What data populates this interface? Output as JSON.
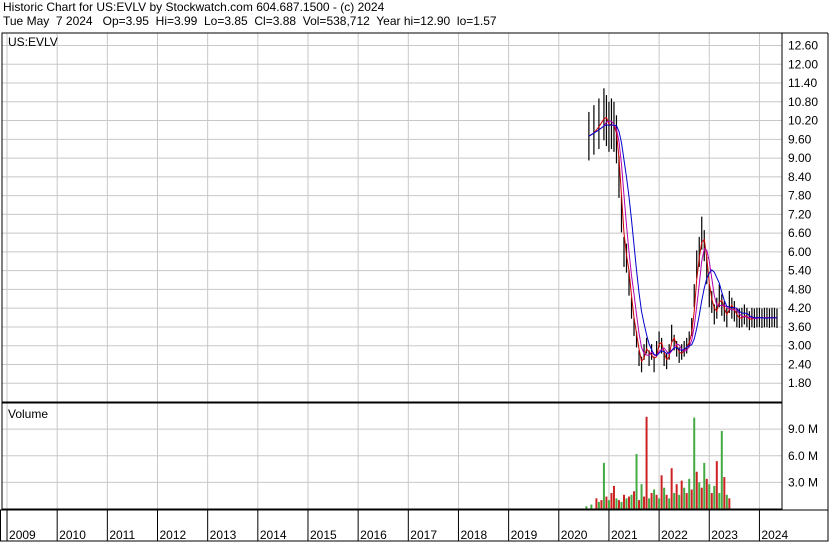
{
  "header": {
    "line1": "Historic Chart for US:EVLV by Stockwatch.com 604.687.1500 - (c) 2024",
    "line2": "Tue May  7 2024   Op=3.95  Hi=3.99  Lo=3.85  Cl=3.88  Vol=538,712  Year hi=12.90  lo=1.57"
  },
  "colors": {
    "grid": "#c8c8c8",
    "frame": "#000000",
    "price_bar": "#000000",
    "ma_short": "#cc0000",
    "ma_mid": "#b000b0",
    "ma_long": "#0000cc",
    "vol_up": "#44aa44",
    "vol_down": "#cc2222"
  },
  "chart_data": [
    {
      "type": "line",
      "panel_label": "US:EVLV",
      "ylim": [
        1.2,
        13.0
      ],
      "y_ticks": [
        "12.60",
        "12.00",
        "11.40",
        "10.80",
        "10.20",
        "9.60",
        "9.00",
        "8.40",
        "7.80",
        "7.20",
        "6.60",
        "6.00",
        "5.40",
        "4.80",
        "4.20",
        "3.60",
        "3.00",
        "2.40",
        "1.80"
      ],
      "x_ticks": [
        "2009",
        "2010",
        "2011",
        "2012",
        "2013",
        "2014",
        "2015",
        "2016",
        "2017",
        "2018",
        "2019",
        "2020",
        "2021",
        "2022",
        "2023",
        "2024"
      ],
      "xlim": [
        2008.9,
        2024.45
      ],
      "series": [
        {
          "x": [
            2020.6,
            2020.7,
            2020.8,
            2020.9,
            2020.95,
            2021.0,
            2021.05,
            2021.1,
            2021.15,
            2021.2,
            2021.25,
            2021.3,
            2021.35,
            2021.4,
            2021.45,
            2021.5,
            2021.55,
            2021.6,
            2021.65,
            2021.7,
            2021.75,
            2021.8,
            2021.85,
            2021.9,
            2021.95,
            2022.0,
            2022.05,
            2022.1,
            2022.15,
            2022.2,
            2022.25,
            2022.3,
            2022.35,
            2022.4,
            2022.45,
            2022.5,
            2022.55,
            2022.6,
            2022.65,
            2022.7,
            2022.75,
            2022.8,
            2022.85,
            2022.9,
            2022.95,
            2023.0,
            2023.05,
            2023.1,
            2023.15,
            2023.2,
            2023.25,
            2023.3,
            2023.35,
            2023.4,
            2023.45,
            2023.5,
            2023.55,
            2023.6,
            2023.65,
            2023.7,
            2023.75,
            2023.8,
            2023.85,
            2023.9,
            2023.95,
            2024.0,
            2024.05,
            2024.1,
            2024.15,
            2024.2,
            2024.25,
            2024.3,
            2024.35
          ],
          "values": [
            9.7,
            9.9,
            10.1,
            10.4,
            10.2,
            10.0,
            10.1,
            10.0,
            9.6,
            8.4,
            7.2,
            6.0,
            5.8,
            5.0,
            4.2,
            3.6,
            3.2,
            2.6,
            2.4,
            2.8,
            3.0,
            2.6,
            2.8,
            2.4,
            2.9,
            3.2,
            3.0,
            2.6,
            2.5,
            2.8,
            3.4,
            3.1,
            2.9,
            2.7,
            2.8,
            2.9,
            3.0,
            3.2,
            3.6,
            4.6,
            5.6,
            6.0,
            6.6,
            6.2,
            5.4,
            4.6,
            4.4,
            4.0,
            4.2,
            4.6,
            4.3,
            4.1,
            3.9,
            4.4,
            4.2,
            4.1,
            3.9,
            3.88,
            3.9,
            4.0,
            3.9,
            3.8,
            3.9,
            3.88,
            3.9,
            3.9,
            3.88,
            3.9,
            3.9,
            3.88,
            3.9,
            3.9,
            3.88
          ],
          "name": ""
        }
      ]
    },
    {
      "type": "bar",
      "panel_label": "Volume",
      "ylim": [
        0,
        11.5
      ],
      "y_ticks": [
        "9.0 M",
        "6.0 M",
        "3.0 M"
      ],
      "unit": "M",
      "x": [
        2020.55,
        2020.65,
        2020.75,
        2020.8,
        2020.85,
        2020.9,
        2020.95,
        2021.0,
        2021.05,
        2021.1,
        2021.15,
        2021.2,
        2021.25,
        2021.3,
        2021.35,
        2021.4,
        2021.45,
        2021.5,
        2021.55,
        2021.6,
        2021.65,
        2021.7,
        2021.75,
        2021.8,
        2021.85,
        2021.9,
        2021.95,
        2022.0,
        2022.05,
        2022.1,
        2022.15,
        2022.2,
        2022.25,
        2022.3,
        2022.35,
        2022.4,
        2022.45,
        2022.5,
        2022.55,
        2022.6,
        2022.65,
        2022.7,
        2022.75,
        2022.8,
        2022.85,
        2022.9,
        2022.95,
        2023.0,
        2023.05,
        2023.1,
        2023.15,
        2023.2,
        2023.25,
        2023.3,
        2023.35,
        2023.4
      ],
      "values": [
        0.3,
        0.5,
        1.2,
        0.8,
        1.0,
        5.2,
        1.4,
        1.0,
        1.8,
        2.6,
        1.2,
        1.0,
        0.8,
        1.6,
        1.2,
        1.4,
        1.6,
        2.0,
        6.2,
        1.0,
        2.8,
        1.4,
        10.4,
        1.2,
        1.8,
        2.2,
        1.6,
        1.2,
        3.8,
        2.4,
        1.6,
        1.2,
        4.6,
        1.8,
        2.8,
        1.6,
        3.2,
        2.4,
        1.8,
        3.4,
        2.2,
        10.3,
        4.2,
        3.0,
        2.4,
        5.2,
        3.4,
        2.8,
        1.8,
        2.6,
        5.4,
        1.8,
        8.8,
        3.6,
        1.6,
        1.2
      ],
      "colors": [
        "up",
        "up",
        "down",
        "up",
        "down",
        "up",
        "down",
        "up",
        "down",
        "down",
        "up",
        "down",
        "up",
        "down",
        "up",
        "down",
        "up",
        "down",
        "up",
        "down",
        "up",
        "down",
        "down",
        "up",
        "down",
        "up",
        "down",
        "up",
        "down",
        "up",
        "down",
        "up",
        "down",
        "up",
        "down",
        "up",
        "down",
        "up",
        "down",
        "up",
        "down",
        "up",
        "down",
        "up",
        "down",
        "up",
        "down",
        "up",
        "down",
        "up",
        "down",
        "up",
        "up",
        "down",
        "up",
        "down"
      ]
    }
  ]
}
